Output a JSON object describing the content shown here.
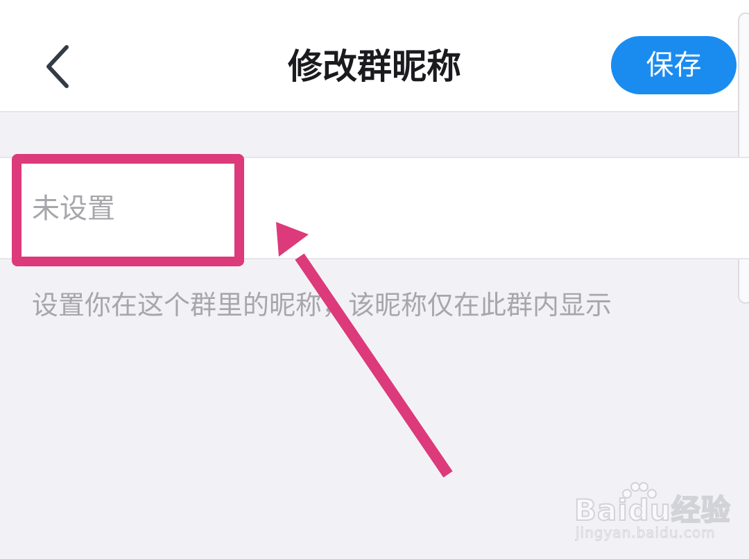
{
  "header": {
    "title": "修改群昵称",
    "back_icon": "chevron-left-icon",
    "save_label": "保存"
  },
  "nickname_input": {
    "value": "",
    "placeholder": "未设置"
  },
  "hint": "设置你在这个群里的昵称，该昵称仅在此群内显示",
  "annotation": {
    "highlight_color": "#dc3a7a",
    "arrow_color": "#dc3a7a"
  },
  "watermark": {
    "brand": "Baidu经验",
    "url": "jingyan.baidu.com"
  },
  "colors": {
    "accent": "#1a8cf0",
    "background": "#f2f2f6",
    "header_bg": "#ffffff",
    "title_text": "#1b1b1f",
    "placeholder_text": "#a6a6ab"
  }
}
